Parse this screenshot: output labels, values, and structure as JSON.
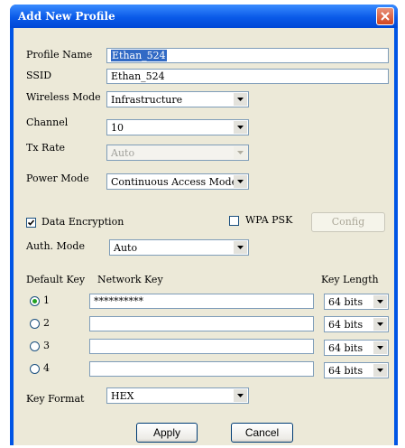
{
  "window": {
    "title": "Add New Profile"
  },
  "profile_name": {
    "label": "Profile Name",
    "value": "Ethan_524"
  },
  "ssid": {
    "label": "SSID",
    "value": "Ethan_524"
  },
  "wireless_mode": {
    "label": "Wireless Mode",
    "value": "Infrastructure"
  },
  "channel": {
    "label": "Channel",
    "value": "10"
  },
  "tx_rate": {
    "label": "Tx Rate",
    "value": "Auto"
  },
  "power_mode": {
    "label": "Power Mode",
    "value": "Continuous Access Mode"
  },
  "data_encryption": {
    "label": "Data Encryption",
    "checked": true
  },
  "wpa_psk": {
    "label": "WPA PSK",
    "checked": false
  },
  "config_button": "Config",
  "auth_mode": {
    "label": "Auth. Mode",
    "value": "Auto"
  },
  "keys": {
    "default_key_label": "Default Key",
    "network_key_label": "Network Key",
    "key_length_label": "Key Length",
    "rows": [
      {
        "label": "1",
        "selected": true,
        "value": "**********",
        "length": "64 bits"
      },
      {
        "label": "2",
        "selected": false,
        "value": "",
        "length": "64 bits"
      },
      {
        "label": "3",
        "selected": false,
        "value": "",
        "length": "64 bits"
      },
      {
        "label": "4",
        "selected": false,
        "value": "",
        "length": "64 bits"
      }
    ]
  },
  "key_format": {
    "label": "Key Format",
    "value": "HEX"
  },
  "buttons": {
    "apply": "Apply",
    "cancel": "Cancel"
  },
  "colors": {
    "title_bar": "#0a5ae8",
    "client": "#ece9d8",
    "close": "#d2461f"
  }
}
